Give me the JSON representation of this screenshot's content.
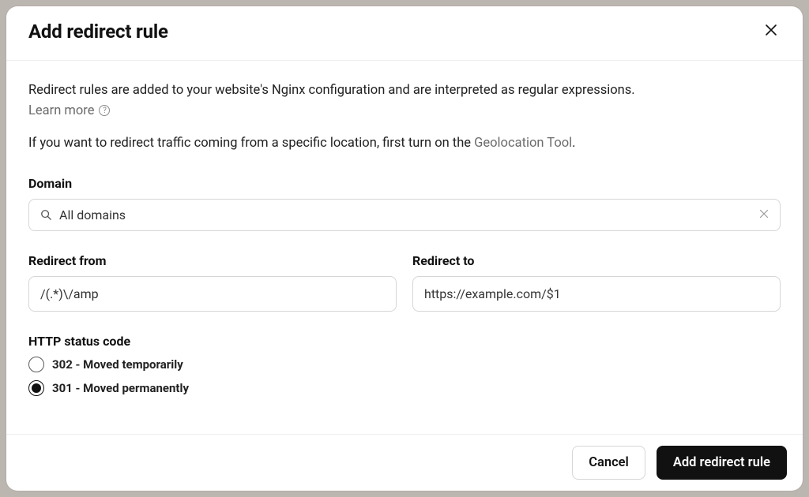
{
  "header": {
    "title": "Add redirect rule"
  },
  "description": "Redirect rules are added to your website's Nginx configuration and are interpreted as regular expressions.",
  "learn_more": "Learn more",
  "secondary_description_prefix": "If you want to redirect traffic coming from a specific location, first turn on the ",
  "geolocation_link": "Geolocation Tool",
  "secondary_description_suffix": ".",
  "domain": {
    "label": "Domain",
    "value": "All domains"
  },
  "redirect_from": {
    "label": "Redirect from",
    "value": "/(.*)\\/amp"
  },
  "redirect_to": {
    "label": "Redirect to",
    "value": "https://example.com/$1"
  },
  "status": {
    "label": "HTTP status code",
    "options": [
      {
        "value": "302",
        "label": "302 - Moved temporarily",
        "selected": false
      },
      {
        "value": "301",
        "label": "301 - Moved permanently",
        "selected": true
      }
    ]
  },
  "footer": {
    "cancel": "Cancel",
    "submit": "Add redirect rule"
  }
}
